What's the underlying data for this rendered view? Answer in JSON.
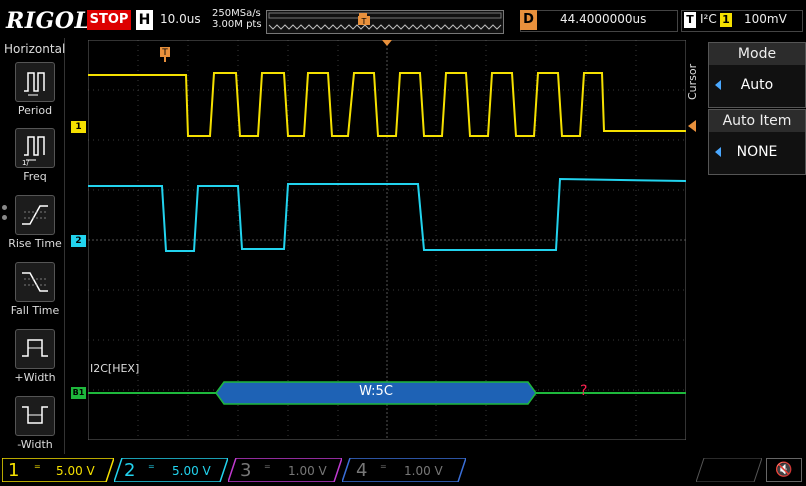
{
  "topbar": {
    "logo": "RIGOL",
    "run_state": "STOP",
    "h_badge": "H",
    "timebase": "10.0us",
    "sample_rate": "250MSa/s",
    "memory_depth": "3.00M pts",
    "trigger_marker": "T",
    "delay_badge": "D",
    "delay_value": "44.4000000us",
    "trigger_badge": "T",
    "trigger_source": "I²C",
    "trigger_channel": "1",
    "trigger_level": "100mV"
  },
  "left_menu": {
    "title": "Horizontal",
    "items": [
      {
        "label": "Period",
        "icon": "period-icon"
      },
      {
        "label": "Freq",
        "icon": "freq-icon"
      },
      {
        "label": "Rise Time",
        "icon": "rise-time-icon"
      },
      {
        "label": "Fall Time",
        "icon": "fall-time-icon"
      },
      {
        "label": "+Width",
        "icon": "positive-width-icon"
      },
      {
        "label": "-Width",
        "icon": "negative-width-icon"
      }
    ]
  },
  "waveform": {
    "ch1_marker": "1",
    "ch2_marker": "2",
    "decoder_marker": "B1",
    "decoder_label": "I2C[HEX]",
    "decoded_packet": "W:5C",
    "error_mark": "?",
    "ch1_color": "#f5e000",
    "ch2_color": "#22d3ee",
    "bus_color": "#1eb83c",
    "packet_color": "#1e62b5"
  },
  "right_panel": {
    "cursor_label": "Cursor",
    "mode_title": "Mode",
    "mode_value": "Auto",
    "auto_item_title": "Auto Item",
    "auto_item_value": "NONE"
  },
  "channels": [
    {
      "num": "1",
      "scale": "5.00 V",
      "color": "#f5e000",
      "active": true
    },
    {
      "num": "2",
      "scale": "5.00 V",
      "color": "#22d3ee",
      "active": true
    },
    {
      "num": "3",
      "scale": "1.00 V",
      "color": "#c03ad0",
      "active": false
    },
    {
      "num": "4",
      "scale": "1.00 V",
      "color": "#3a6fd8",
      "active": false
    }
  ]
}
